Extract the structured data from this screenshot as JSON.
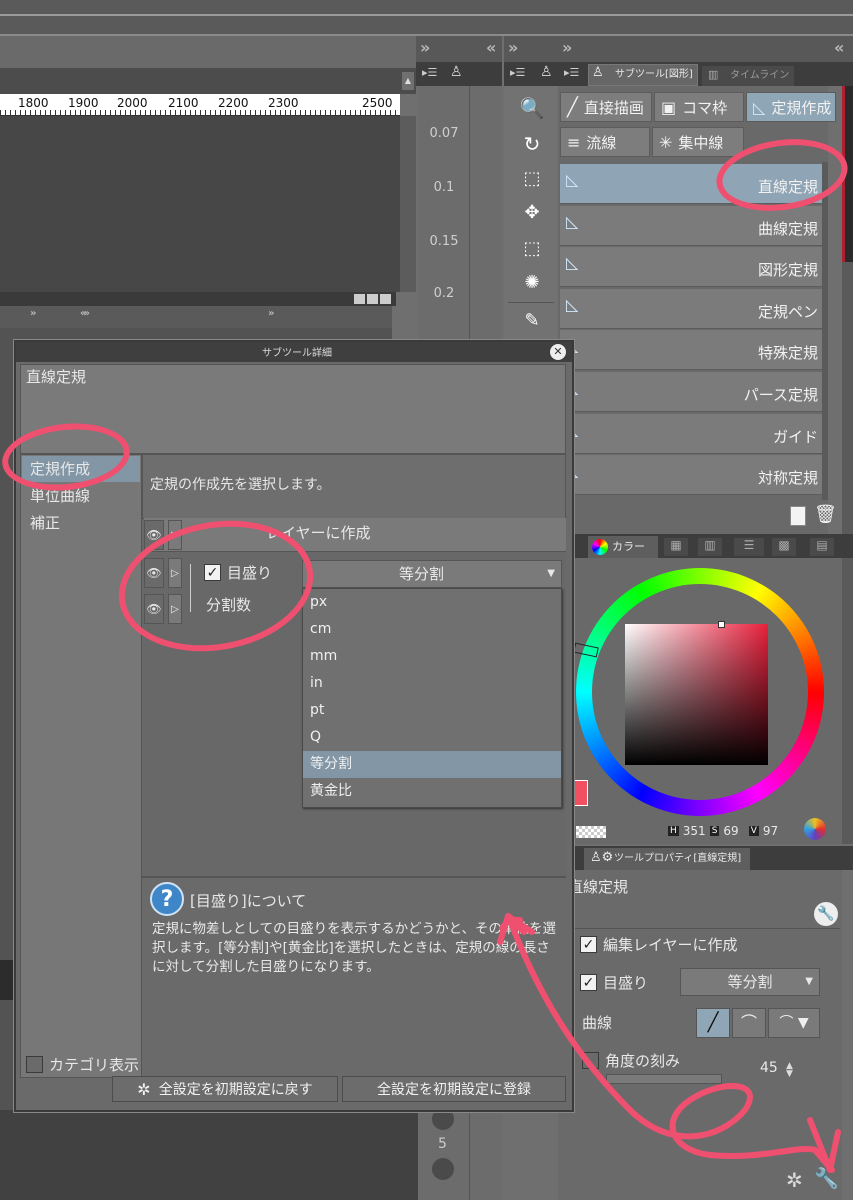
{
  "ruler": {
    "ticks": [
      "1800",
      "1900",
      "2000",
      "2100",
      "2200",
      "2300",
      "2500"
    ]
  },
  "rotation_strip": {
    "values": [
      "0.07",
      "0.1",
      "0.15",
      "0.2"
    ],
    "bottom_value": "5"
  },
  "subtool_panel": {
    "tab_title": "サブツール[図形]",
    "tab_timeline": "タイムライン",
    "tabs": [
      {
        "label": "直接描画",
        "active": false
      },
      {
        "label": "コマ枠",
        "active": false
      },
      {
        "label": "定規作成",
        "active": true
      },
      {
        "label": "流線",
        "active": false
      },
      {
        "label": "集中線",
        "active": false
      }
    ],
    "items": [
      {
        "label": "直線定規",
        "selected": true
      },
      {
        "label": "曲線定規",
        "selected": false
      },
      {
        "label": "図形定規",
        "selected": false
      },
      {
        "label": "定規ペン",
        "selected": false
      },
      {
        "label": "特殊定規",
        "selected": false
      },
      {
        "label": "パース定規",
        "selected": false
      },
      {
        "label": "ガイド",
        "selected": false
      },
      {
        "label": "対称定規",
        "selected": false
      }
    ]
  },
  "color_panel": {
    "tab_label": "カラー",
    "h_label": "H",
    "h_value": "351",
    "s_label": "S",
    "s_value": "69",
    "v_label": "V",
    "v_value": "97",
    "main_color": "#f05060"
  },
  "tool_property": {
    "title": "ツールプロパティ[直線定規]",
    "tool_name": "直線定規",
    "rows": {
      "edit_layer": "編集レイヤーに作成",
      "scale": "目盛り",
      "scale_value": "等分割",
      "curve": "曲線",
      "angle": "角度の刻み",
      "angle_value": "45"
    }
  },
  "dialog": {
    "title": "サブツール詳細",
    "tool_name": "直線定規",
    "categories": [
      {
        "label": "定規作成",
        "selected": true
      },
      {
        "label": "単位曲線",
        "selected": false
      },
      {
        "label": "補正",
        "selected": false
      }
    ],
    "description": "定規の作成先を選択します。",
    "row_edit_layer": "レイヤーに作成",
    "row_scale": "目盛り",
    "row_scale_value": "等分割",
    "row_divisions": "分割数",
    "dropdown_options": [
      {
        "label": "px",
        "selected": false
      },
      {
        "label": "cm",
        "selected": false
      },
      {
        "label": "mm",
        "selected": false
      },
      {
        "label": "in",
        "selected": false
      },
      {
        "label": "pt",
        "selected": false
      },
      {
        "label": "Q",
        "selected": false
      },
      {
        "label": "等分割",
        "selected": true
      },
      {
        "label": "黄金比",
        "selected": false
      }
    ],
    "help_title": "[目盛り]について",
    "help_body": "定規に物差しとしての目盛りを表示するかどうかと、その単位を選択します。[等分割]や[黄金比]を選択したときは、定規の線の長さに対して分割した目盛りになります。",
    "category_toggle": "カテゴリ表示",
    "reset_button": "全設定を初期設定に戻す",
    "register_button": "全設定を初期設定に登録"
  },
  "annotation_color": "#f05070"
}
